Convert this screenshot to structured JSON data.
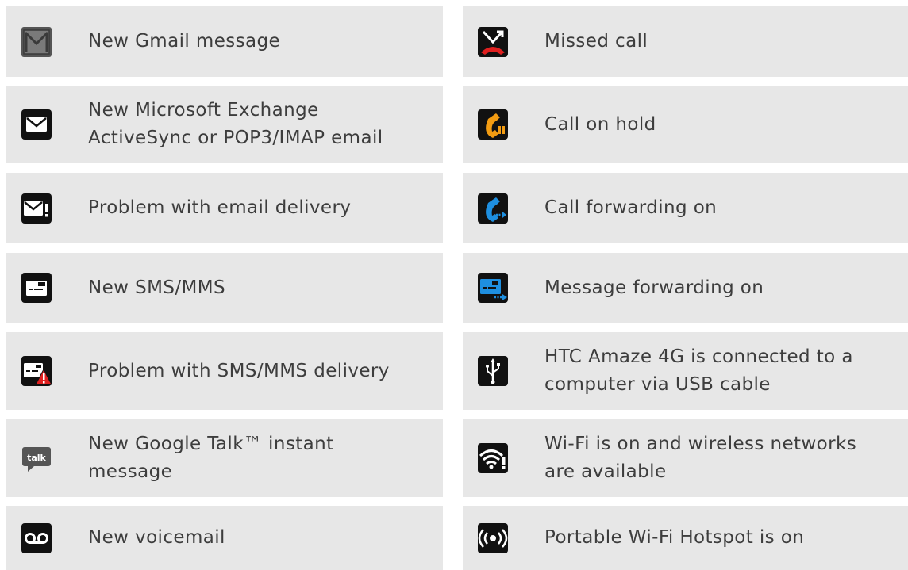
{
  "left_items": [
    {
      "icon": "gmail-icon",
      "label": "New Gmail message"
    },
    {
      "icon": "mail-icon",
      "label": "New Microsoft Exchange\nActiveSync or POP3/IMAP email"
    },
    {
      "icon": "mail-error-icon",
      "label": "Problem with email delivery"
    },
    {
      "icon": "sms-icon",
      "label": "New SMS/MMS"
    },
    {
      "icon": "sms-error-icon",
      "label": "Problem with SMS/MMS delivery"
    },
    {
      "icon": "google-talk-icon",
      "label": "New Google Talk™ instant\nmessage"
    },
    {
      "icon": "voicemail-icon",
      "label": "New voicemail"
    }
  ],
  "right_items": [
    {
      "icon": "missed-call-icon",
      "label": "Missed call"
    },
    {
      "icon": "call-on-hold-icon",
      "label": "Call on hold"
    },
    {
      "icon": "call-forwarding-icon",
      "label": "Call forwarding on"
    },
    {
      "icon": "message-forwarding-icon",
      "label": "Message forwarding on"
    },
    {
      "icon": "usb-icon",
      "label": "HTC Amaze 4G is connected to a\ncomputer via USB cable"
    },
    {
      "icon": "wifi-available-icon",
      "label": "Wi-Fi is on and wireless networks\nare available"
    },
    {
      "icon": "wifi-hotspot-icon",
      "label": "Portable Wi-Fi Hotspot is on"
    }
  ],
  "icon_text": {
    "talk": "talk"
  },
  "colors": {
    "row_background": "#e7e7e7",
    "text": "#3d3d3d",
    "icon_tile": "#111111",
    "accent_orange": "#f39c12",
    "accent_blue": "#1e8fe0",
    "accent_red": "#e02020"
  }
}
